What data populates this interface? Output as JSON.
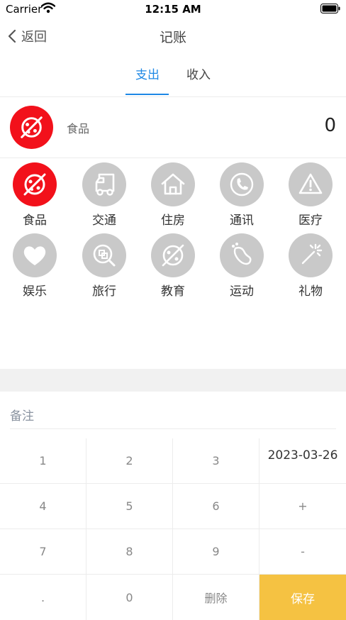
{
  "status_bar": {
    "carrier": "Carrier",
    "time": "12:15 AM"
  },
  "nav": {
    "back_label": "返回",
    "title": "记账"
  },
  "tabs": [
    {
      "label": "支出",
      "active": true
    },
    {
      "label": "收入",
      "active": false
    }
  ],
  "selected": {
    "category": "食品",
    "amount": "0"
  },
  "categories": [
    {
      "label": "食品",
      "icon": "food-icon",
      "selected": true
    },
    {
      "label": "交通",
      "icon": "truck-icon",
      "selected": false
    },
    {
      "label": "住房",
      "icon": "house-icon",
      "selected": false
    },
    {
      "label": "通讯",
      "icon": "phone-icon",
      "selected": false
    },
    {
      "label": "医疗",
      "icon": "warning-icon",
      "selected": false
    },
    {
      "label": "娱乐",
      "icon": "heart-icon",
      "selected": false
    },
    {
      "label": "旅行",
      "icon": "travel-search-icon",
      "selected": false
    },
    {
      "label": "教育",
      "icon": "education-icon",
      "selected": false
    },
    {
      "label": "运动",
      "icon": "footprint-icon",
      "selected": false
    },
    {
      "label": "礼物",
      "icon": "sparkle-icon",
      "selected": false
    }
  ],
  "note": {
    "placeholder": "备注"
  },
  "keypad": {
    "date": "2023-03-26",
    "keys": [
      "1",
      "2",
      "3",
      "4",
      "5",
      "6",
      "+",
      "7",
      "8",
      "9",
      "-",
      ".",
      "0",
      "删除",
      "保存"
    ]
  },
  "colors": {
    "accent": "#1e88e5",
    "selected_icon": "#f2111b",
    "unselected_icon": "#c9c9c9",
    "save_button": "#f5c242"
  }
}
